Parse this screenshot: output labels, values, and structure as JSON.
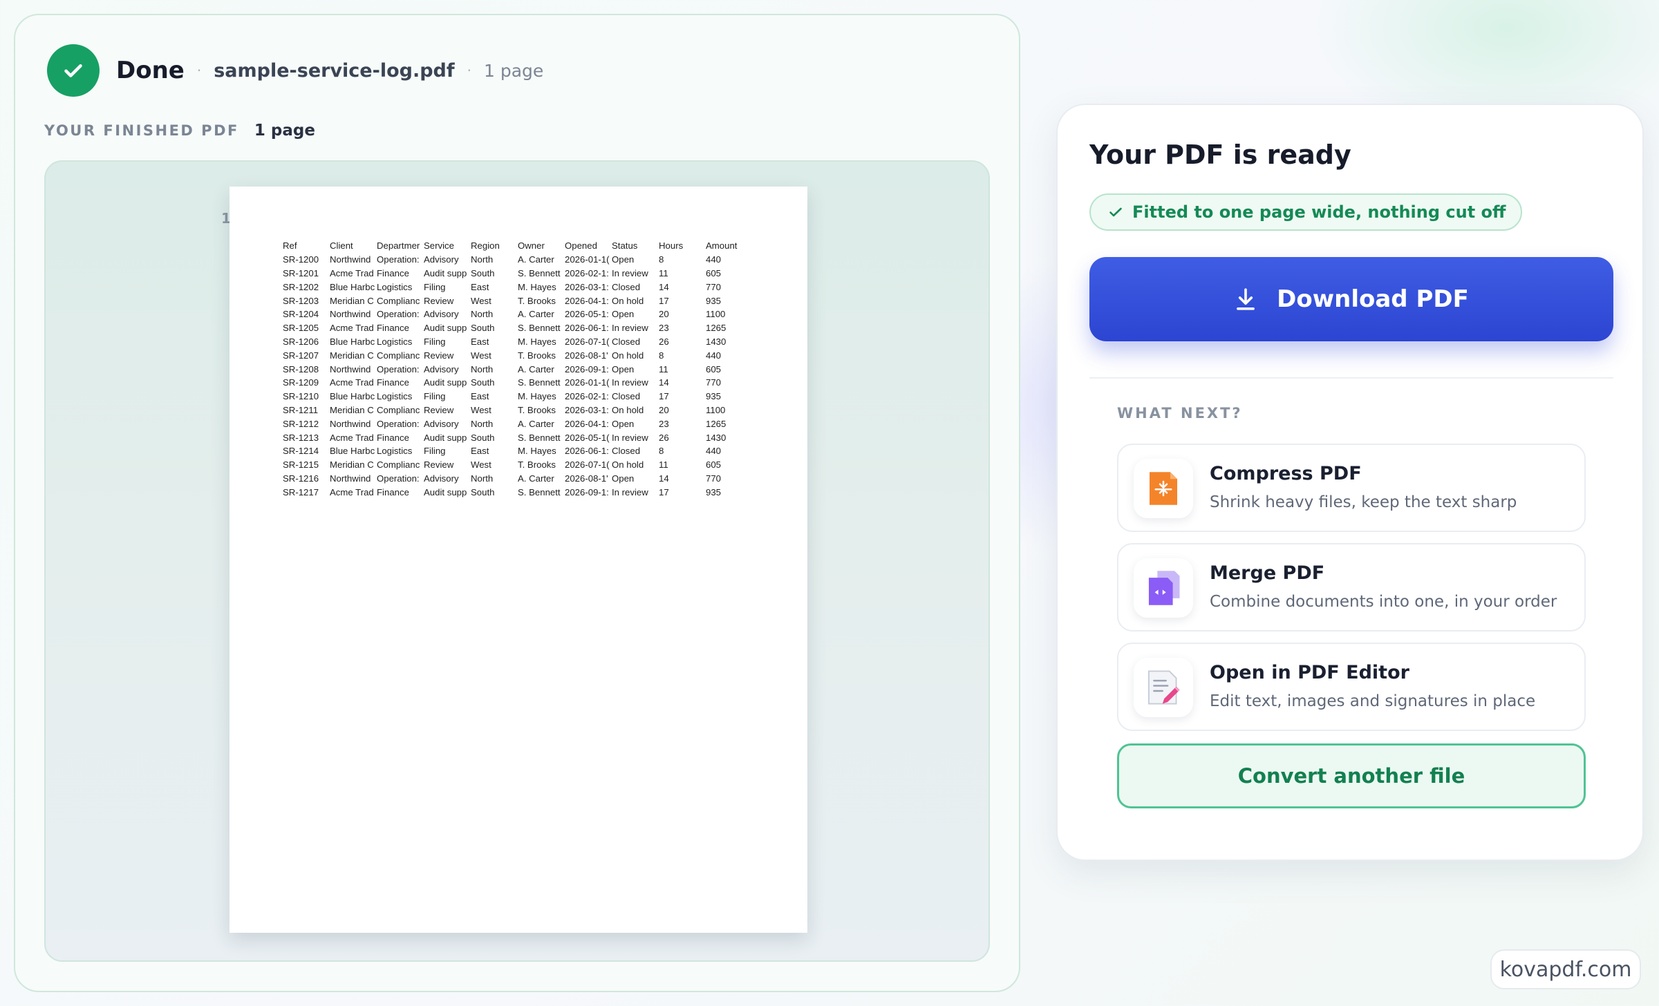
{
  "header": {
    "status": "Done",
    "separator": "·",
    "file_name": "sample-service-log.pdf",
    "page_count": "1 page"
  },
  "preview": {
    "section_label": "YOUR FINISHED PDF",
    "section_pages": "1 page",
    "page_number": "1",
    "table": {
      "columns": [
        "Ref",
        "Client",
        "Departmer",
        "Service",
        "Region",
        "Owner",
        "Opened",
        "Status",
        "Hours",
        "Amount"
      ],
      "rows": [
        [
          "SR-1200",
          "Northwind",
          "Operation:",
          "Advisory",
          "North",
          "A. Carter",
          "2026-01-1(",
          "Open",
          "8",
          "440"
        ],
        [
          "SR-1201",
          "Acme Trad",
          "Finance",
          "Audit supp",
          "South",
          "S. Bennett",
          "2026-02-1:",
          "In review",
          "11",
          "605"
        ],
        [
          "SR-1202",
          "Blue Harbc",
          "Logistics",
          "Filing",
          "East",
          "M. Hayes",
          "2026-03-1:",
          "Closed",
          "14",
          "770"
        ],
        [
          "SR-1203",
          "Meridian C",
          "Complianc",
          "Review",
          "West",
          "T. Brooks",
          "2026-04-1:",
          "On hold",
          "17",
          "935"
        ],
        [
          "SR-1204",
          "Northwind",
          "Operation:",
          "Advisory",
          "North",
          "A. Carter",
          "2026-05-1:",
          "Open",
          "20",
          "1100"
        ],
        [
          "SR-1205",
          "Acme Trad",
          "Finance",
          "Audit supp",
          "South",
          "S. Bennett",
          "2026-06-1:",
          "In review",
          "23",
          "1265"
        ],
        [
          "SR-1206",
          "Blue Harbc",
          "Logistics",
          "Filing",
          "East",
          "M. Hayes",
          "2026-07-1(",
          "Closed",
          "26",
          "1430"
        ],
        [
          "SR-1207",
          "Meridian C",
          "Complianc",
          "Review",
          "West",
          "T. Brooks",
          "2026-08-1'",
          "On hold",
          "8",
          "440"
        ],
        [
          "SR-1208",
          "Northwind",
          "Operation:",
          "Advisory",
          "North",
          "A. Carter",
          "2026-09-1:",
          "Open",
          "11",
          "605"
        ],
        [
          "SR-1209",
          "Acme Trad",
          "Finance",
          "Audit supp",
          "South",
          "S. Bennett",
          "2026-01-1(",
          "In review",
          "14",
          "770"
        ],
        [
          "SR-1210",
          "Blue Harbc",
          "Logistics",
          "Filing",
          "East",
          "M. Hayes",
          "2026-02-1:",
          "Closed",
          "17",
          "935"
        ],
        [
          "SR-1211",
          "Meridian C",
          "Complianc",
          "Review",
          "West",
          "T. Brooks",
          "2026-03-1:",
          "On hold",
          "20",
          "1100"
        ],
        [
          "SR-1212",
          "Northwind",
          "Operation:",
          "Advisory",
          "North",
          "A. Carter",
          "2026-04-1:",
          "Open",
          "23",
          "1265"
        ],
        [
          "SR-1213",
          "Acme Trad",
          "Finance",
          "Audit supp",
          "South",
          "S. Bennett",
          "2026-05-1(",
          "In review",
          "26",
          "1430"
        ],
        [
          "SR-1214",
          "Blue Harbc",
          "Logistics",
          "Filing",
          "East",
          "M. Hayes",
          "2026-06-1:",
          "Closed",
          "8",
          "440"
        ],
        [
          "SR-1215",
          "Meridian C",
          "Complianc",
          "Review",
          "West",
          "T. Brooks",
          "2026-07-1(",
          "On hold",
          "11",
          "605"
        ],
        [
          "SR-1216",
          "Northwind",
          "Operation:",
          "Advisory",
          "North",
          "A. Carter",
          "2026-08-1'",
          "Open",
          "14",
          "770"
        ],
        [
          "SR-1217",
          "Acme Trad",
          "Finance",
          "Audit supp",
          "South",
          "S. Bennett",
          "2026-09-1:",
          "In review",
          "17",
          "935"
        ]
      ]
    }
  },
  "panel": {
    "title": "Your PDF is ready",
    "fit_badge": "Fitted to one page wide, nothing cut off",
    "download_label": "Download PDF",
    "what_next_label": "WHAT NEXT?",
    "options": [
      {
        "title": "Compress PDF",
        "description": "Shrink heavy files, keep the text sharp",
        "icon": "compress-icon"
      },
      {
        "title": "Merge PDF",
        "description": "Combine documents into one, in your order",
        "icon": "merge-icon"
      },
      {
        "title": "Open in PDF Editor",
        "description": "Edit text, images and signatures in place",
        "icon": "editor-icon"
      }
    ],
    "convert_label": "Convert another file"
  },
  "brand": "kovapdf.com",
  "colors": {
    "accent_green": "#17a064",
    "download_blue": "#3450dc",
    "compress_orange": "#f4842a",
    "merge_purple": "#8b5cf6",
    "editor_pink": "#e8478b"
  }
}
